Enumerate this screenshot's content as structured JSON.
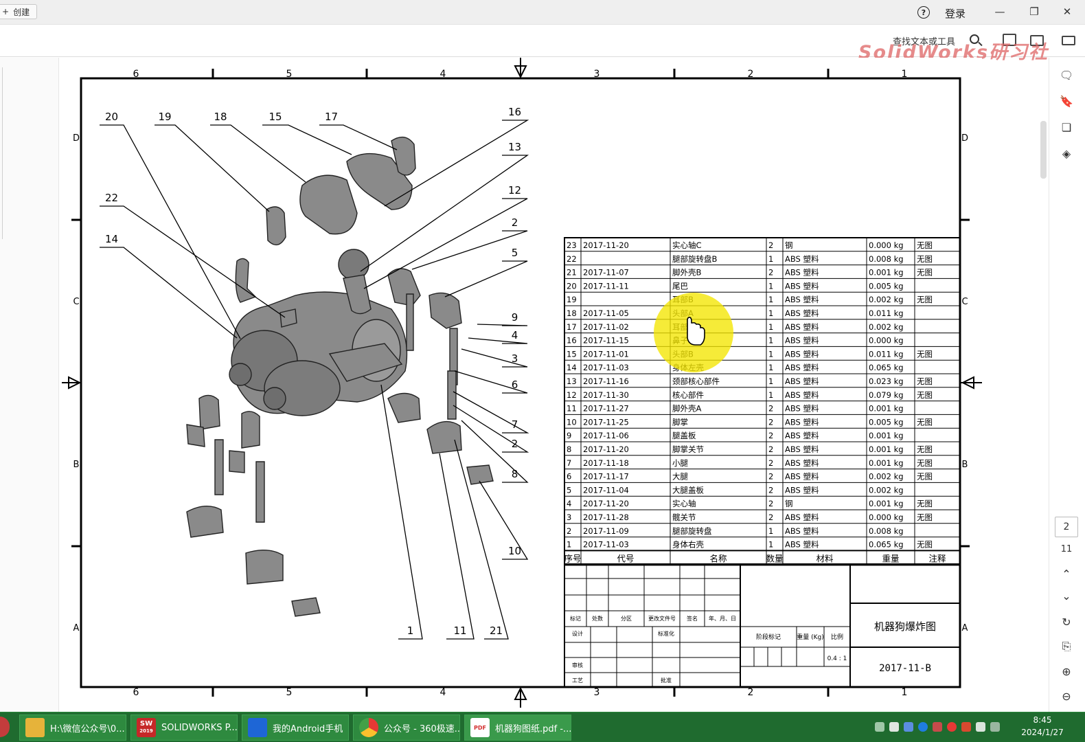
{
  "window": {
    "create_label": "创建",
    "help_icon": "question-circle-icon",
    "login_label": "登录",
    "minimize_icon": "minimize-icon",
    "restore_icon": "restore-icon",
    "close_icon": "close-icon"
  },
  "toolbar": {
    "search_placeholder": "查找文本或工具"
  },
  "watermark": "SolidWorks研习社",
  "drawing": {
    "zone_cols": [
      "6",
      "5",
      "4",
      "3",
      "2",
      "1"
    ],
    "zone_rows": [
      "D",
      "C",
      "B",
      "A"
    ],
    "balloons": [
      "20",
      "19",
      "18",
      "15",
      "17",
      "16",
      "13",
      "12",
      "22",
      "14",
      "2",
      "5",
      "9",
      "4",
      "3",
      "6",
      "7",
      "2",
      "8",
      "10",
      "1",
      "11",
      "21"
    ],
    "bom": [
      [
        "23",
        "2017-11-20",
        "实心轴C",
        "2",
        "钢",
        "0.000 kg",
        "无图"
      ],
      [
        "22",
        "",
        "腿部旋转盘B",
        "1",
        "ABS 塑料",
        "0.008 kg",
        "无图"
      ],
      [
        "21",
        "2017-11-07",
        "脚外壳B",
        "2",
        "ABS 塑料",
        "0.001 kg",
        "无图"
      ],
      [
        "20",
        "2017-11-11",
        "尾巴",
        "1",
        "ABS 塑料",
        "0.005 kg",
        ""
      ],
      [
        "19",
        "",
        "耳部B",
        "1",
        "ABS 塑料",
        "0.002 kg",
        "无图"
      ],
      [
        "18",
        "2017-11-05",
        "头部A",
        "1",
        "ABS 塑料",
        "0.011 kg",
        ""
      ],
      [
        "17",
        "2017-11-02",
        "耳部A",
        "1",
        "ABS 塑料",
        "0.002 kg",
        ""
      ],
      [
        "16",
        "2017-11-15",
        "鼻子",
        "1",
        "ABS 塑料",
        "0.000 kg",
        ""
      ],
      [
        "15",
        "2017-11-01",
        "头部B",
        "1",
        "ABS 塑料",
        "0.011 kg",
        "无图"
      ],
      [
        "14",
        "2017-11-03",
        "身体左壳",
        "1",
        "ABS 塑料",
        "0.065 kg",
        ""
      ],
      [
        "13",
        "2017-11-16",
        "颈部核心部件",
        "1",
        "ABS 塑料",
        "0.023 kg",
        "无图"
      ],
      [
        "12",
        "2017-11-30",
        "核心部件",
        "1",
        "ABS 塑料",
        "0.079 kg",
        "无图"
      ],
      [
        "11",
        "2017-11-27",
        "脚外壳A",
        "2",
        "ABS 塑料",
        "0.001 kg",
        ""
      ],
      [
        "10",
        "2017-11-25",
        "脚掌",
        "2",
        "ABS 塑料",
        "0.005 kg",
        "无图"
      ],
      [
        "9",
        "2017-11-06",
        "腿盖板",
        "2",
        "ABS 塑料",
        "0.001 kg",
        ""
      ],
      [
        "8",
        "2017-11-20",
        "脚掌关节",
        "2",
        "ABS 塑料",
        "0.001 kg",
        "无图"
      ],
      [
        "7",
        "2017-11-18",
        "小腿",
        "2",
        "ABS 塑料",
        "0.001 kg",
        "无图"
      ],
      [
        "6",
        "2017-11-17",
        "大腿",
        "2",
        "ABS 塑料",
        "0.002 kg",
        "无图"
      ],
      [
        "5",
        "2017-11-04",
        "大腿盖板",
        "2",
        "ABS 塑料",
        "0.002 kg",
        ""
      ],
      [
        "4",
        "2017-11-20",
        "实心轴",
        "2",
        "钢",
        "0.001 kg",
        "无图"
      ],
      [
        "3",
        "2017-11-28",
        "髋关节",
        "2",
        "ABS 塑料",
        "0.000 kg",
        "无图"
      ],
      [
        "2",
        "2017-11-09",
        "腿部旋转盘",
        "1",
        "ABS 塑料",
        "0.008 kg",
        ""
      ],
      [
        "1",
        "2017-11-03",
        "身体右壳",
        "1",
        "ABS 塑料",
        "0.065 kg",
        "无图"
      ]
    ],
    "bom_headers": [
      "序号",
      "代号",
      "名称",
      "数量",
      "材料",
      "重量",
      "注释"
    ],
    "tb_sign_headers": [
      "标记",
      "处数",
      "分区",
      "更改文件号",
      "签名",
      "年、月、日"
    ],
    "tb_design": "设计",
    "tb_standard": "标准化",
    "tb_review": "审核",
    "tb_process": "工艺",
    "tb_approve": "批准",
    "tb_stage": "阶段标记",
    "tb_weight": "重量 (Kg)",
    "tb_scale_label": "比例",
    "tb_scale": "0.4 : 1",
    "title": "机器狗爆炸图",
    "drawing_no": "2017-11-B"
  },
  "sidebar_right": {
    "icons": [
      "comment-icon",
      "bookmark-icon",
      "pages-icon",
      "layers-icon"
    ],
    "current_page": "2",
    "total_pages": "11",
    "nav_icons": [
      "chevron-up-icon",
      "chevron-down-icon",
      "rotate-icon",
      "export-icon",
      "zoom-in-icon",
      "zoom-out-icon"
    ]
  },
  "taskbar": {
    "items": [
      {
        "label": "H:\\微信公众号\\0...",
        "icon": "folder-icon",
        "color": "#e6b33a"
      },
      {
        "label": "SOLIDWORKS P...",
        "icon": "solidworks-icon",
        "color": "#c62828"
      },
      {
        "label": "我的Android手机",
        "icon": "phone-icon",
        "color": "#1e66d6"
      },
      {
        "label": "公众号 - 360极速...",
        "icon": "browser-icon",
        "color": "#3b8ee8"
      },
      {
        "label": "机器狗图纸.pdf -...",
        "icon": "pdf-icon",
        "color": "#d32f2f"
      }
    ],
    "sw_badge": "SW",
    "sw_year": "2019",
    "pdf_badge": "PDF",
    "time": "8:45",
    "date": "2024/1/27"
  }
}
